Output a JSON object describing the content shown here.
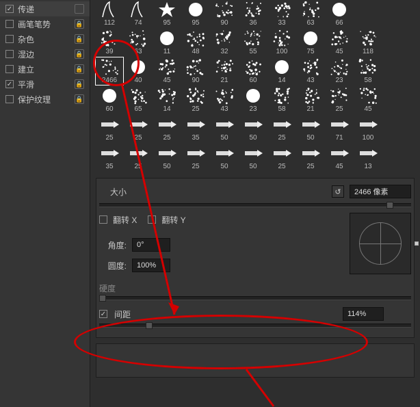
{
  "sidebar": {
    "items": [
      {
        "label": "传递",
        "checked": true,
        "locked": false
      },
      {
        "label": "画笔笔势",
        "checked": false,
        "locked": true
      },
      {
        "label": "杂色",
        "checked": false,
        "locked": true
      },
      {
        "label": "湿边",
        "checked": false,
        "locked": true
      },
      {
        "label": "建立",
        "checked": false,
        "locked": true
      },
      {
        "label": "平滑",
        "checked": true,
        "locked": true
      },
      {
        "label": "保护纹理",
        "checked": false,
        "locked": true
      }
    ]
  },
  "brushes": {
    "rows": [
      [
        112,
        74,
        95,
        95,
        90,
        36,
        33,
        63,
        66
      ],
      [
        39,
        63,
        11,
        48,
        32,
        55,
        100,
        75,
        45,
        118
      ],
      [
        2466,
        40,
        45,
        90,
        21,
        60,
        14,
        43,
        23,
        58
      ],
      [
        60,
        65,
        14,
        25,
        43,
        23,
        58,
        21,
        25,
        45
      ],
      [
        25,
        25,
        25,
        35,
        50,
        50,
        25,
        50,
        71,
        100
      ],
      [
        35,
        25,
        50,
        25,
        50,
        50,
        25,
        25,
        45,
        13
      ]
    ],
    "selected_row": 2,
    "selected_col": 0
  },
  "size": {
    "label": "大小",
    "value": "2466 像素"
  },
  "flip": {
    "x_label": "翻转 X",
    "y_label": "翻转 Y",
    "x": false,
    "y": false
  },
  "angle": {
    "label": "角度:",
    "value": "0°"
  },
  "roundness": {
    "label": "圆度:",
    "value": "100%"
  },
  "hardness": {
    "label": "硬度"
  },
  "spacing": {
    "label": "间距",
    "checked": true,
    "value": "114%"
  }
}
